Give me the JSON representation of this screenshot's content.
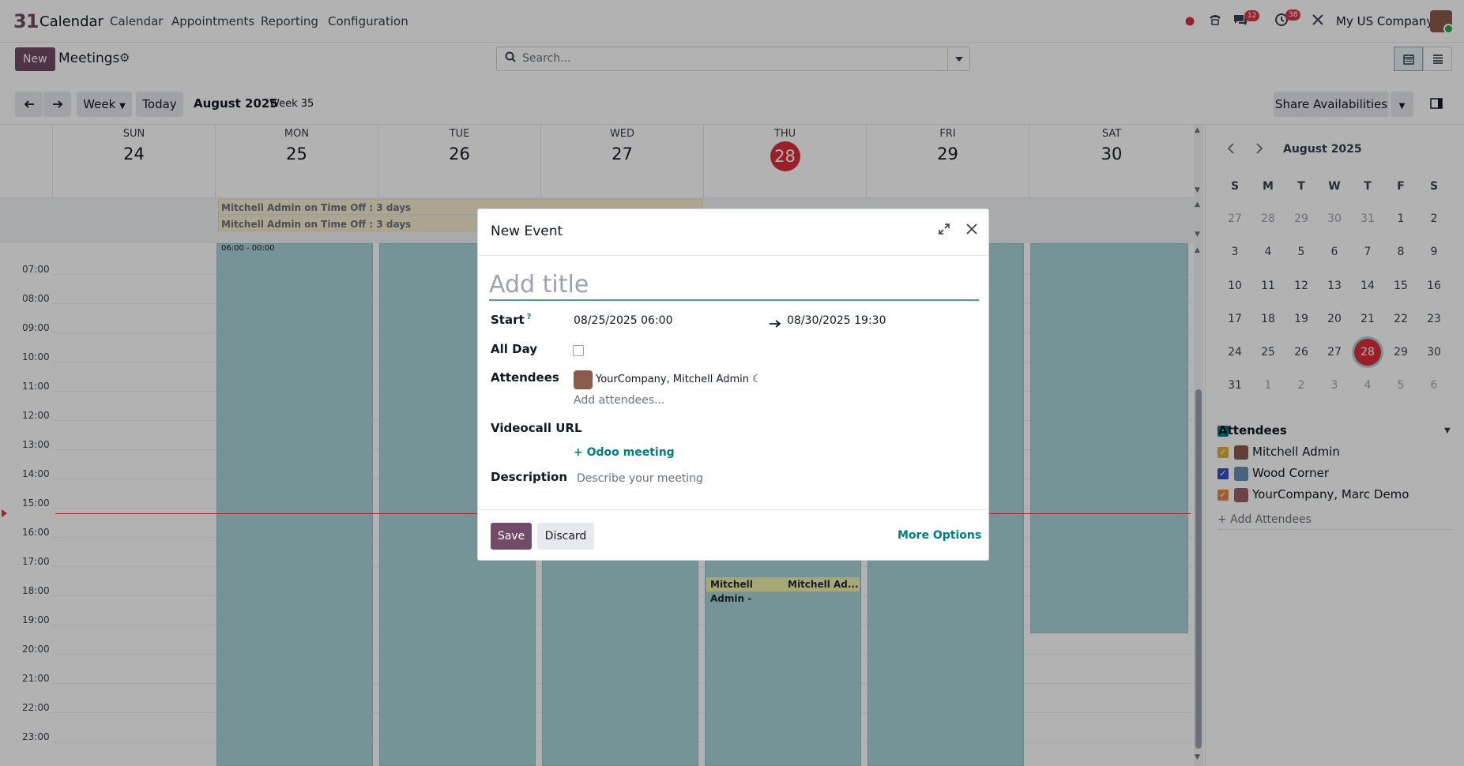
{
  "app": {
    "logo": "31",
    "name": "Calendar",
    "menu": [
      "Calendar",
      "Appointments",
      "Reporting",
      "Configuration"
    ],
    "messages_badge": "12",
    "activities_badge": "38",
    "company": "My US Company"
  },
  "control": {
    "new_label": "New",
    "title": "Meetings",
    "search_placeholder": "Search..."
  },
  "toolbar": {
    "scale_label": "Week",
    "today_label": "Today",
    "period": "August 2025",
    "week": "Week 35",
    "share_label": "Share Availabilities"
  },
  "week": {
    "days": [
      {
        "name": "SUN",
        "num": "24"
      },
      {
        "name": "MON",
        "num": "25"
      },
      {
        "name": "TUE",
        "num": "26"
      },
      {
        "name": "WED",
        "num": "27"
      },
      {
        "name": "THU",
        "num": "28",
        "today": true
      },
      {
        "name": "FRI",
        "num": "29"
      },
      {
        "name": "SAT",
        "num": "30"
      }
    ],
    "allday_events": [
      "Mitchell Admin on Time Off : 3 days",
      "Mitchell Admin on Time Off : 3 days"
    ],
    "hours": [
      "07:00",
      "08:00",
      "09:00",
      "10:00",
      "11:00",
      "12:00",
      "13:00",
      "14:00",
      "15:00",
      "16:00",
      "17:00",
      "18:00",
      "19:00",
      "20:00",
      "21:00",
      "22:00",
      "23:00"
    ],
    "block_time_label": "06:00 - 00:00",
    "yellow_events": [
      "Mitchell Admin -",
      "Mitchell Ad..."
    ]
  },
  "sidebar": {
    "month": "August 2025",
    "weekdays": [
      "S",
      "M",
      "T",
      "W",
      "T",
      "F",
      "S"
    ],
    "weeks": [
      [
        "27",
        "28",
        "29",
        "30",
        "31",
        "1",
        "2"
      ],
      [
        "3",
        "4",
        "5",
        "6",
        "7",
        "8",
        "9"
      ],
      [
        "10",
        "11",
        "12",
        "13",
        "14",
        "15",
        "16"
      ],
      [
        "17",
        "18",
        "19",
        "20",
        "21",
        "22",
        "23"
      ],
      [
        "24",
        "25",
        "26",
        "27",
        "28",
        "29",
        "30"
      ],
      [
        "31",
        "1",
        "2",
        "3",
        "4",
        "5",
        "6"
      ]
    ],
    "attendees_title": "Attendees",
    "attendees": [
      {
        "name": "Mitchell Admin",
        "color": "#e0b13a"
      },
      {
        "name": "Wood Corner",
        "color": "#3b4cc0"
      },
      {
        "name": "YourCompany, Marc Demo",
        "color": "#e08a4a"
      }
    ],
    "add_attendees": "+ Add Attendees"
  },
  "dialog": {
    "title": "New Event",
    "title_placeholder": "Add title",
    "start_label": "Start",
    "start_help": "?",
    "start_value": "08/25/2025 06:00",
    "end_value": "08/30/2025 19:30",
    "allday_label": "All Day",
    "attendees_label": "Attendees",
    "attendee_name": "YourCompany, Mitchell Admin",
    "add_attendees_placeholder": "Add attendees...",
    "videocall_label": "Videocall URL",
    "odoo_meeting": "Odoo meeting",
    "description_label": "Description",
    "description_placeholder": "Describe your meeting",
    "save_label": "Save",
    "discard_label": "Discard",
    "more_options": "More Options"
  },
  "colors": {
    "primary": "#714b67",
    "accent": "#017e84",
    "today": "#dc2f3c",
    "event_block": "#a9d4d8",
    "timeoff": "#f5edd0"
  }
}
